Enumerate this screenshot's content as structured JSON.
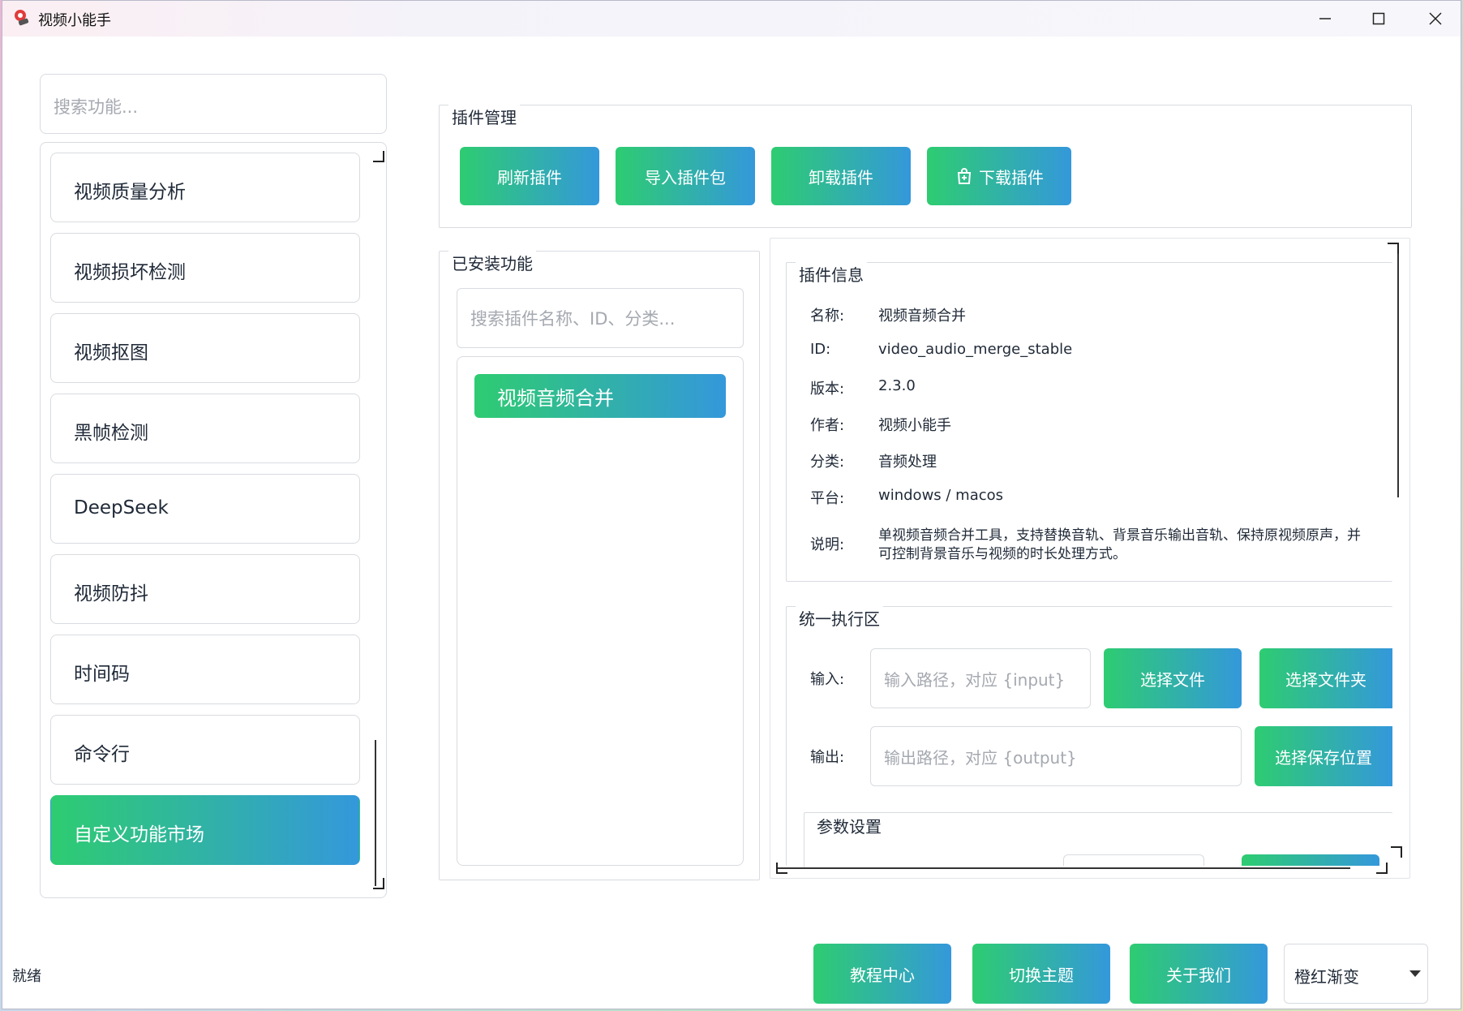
{
  "window": {
    "title": "视频小能手"
  },
  "sidebar": {
    "search_placeholder": "搜索功能...",
    "items": [
      {
        "label": "视频质量分析"
      },
      {
        "label": "视频损坏检测"
      },
      {
        "label": "视频抠图"
      },
      {
        "label": "黑帧检测"
      },
      {
        "label": "DeepSeek"
      },
      {
        "label": "视频防抖"
      },
      {
        "label": "时间码"
      },
      {
        "label": "命令行"
      },
      {
        "label": "自定义功能市场",
        "active": true
      }
    ]
  },
  "plugin_management": {
    "title": "插件管理",
    "buttons": {
      "refresh": "刷新插件",
      "import": "导入插件包",
      "uninstall": "卸载插件",
      "download": "下载插件"
    }
  },
  "installed": {
    "title": "已安装功能",
    "search_placeholder": "搜索插件名称、ID、分类...",
    "items": [
      {
        "label": "视频音频合并"
      }
    ]
  },
  "plugin_info": {
    "title": "插件信息",
    "rows": [
      {
        "label": "名称:",
        "value": "视频音频合并"
      },
      {
        "label": "ID:",
        "value": "video_audio_merge_stable"
      },
      {
        "label": "版本:",
        "value": "2.3.0"
      },
      {
        "label": "作者:",
        "value": "视频小能手"
      },
      {
        "label": "分类:",
        "value": "音频处理"
      },
      {
        "label": "平台:",
        "value": "windows / macos"
      }
    ],
    "description_label": "说明:",
    "description_line1": "单视频音频合并工具，支持替换音轨、背景音乐输出音轨、保持原视频原声，并",
    "description_line2": "可控制背景音乐与视频的时长处理方式。"
  },
  "execution": {
    "title": "统一执行区",
    "input_label": "输入:",
    "input_placeholder": "输入路径，对应 {input}",
    "select_file": "选择文件",
    "select_folder": "选择文件夹",
    "output_label": "输出:",
    "output_placeholder": "输出路径，对应 {output}",
    "select_save": "选择保存位置",
    "params_title": "参数设置"
  },
  "footer": {
    "status": "就绪",
    "tutorial": "教程中心",
    "switch_theme": "切换主题",
    "about": "关于我们",
    "theme_value": "橙红渐变"
  },
  "colors": {
    "gradient_start": "#2ecc71",
    "gradient_end": "#3498db"
  }
}
